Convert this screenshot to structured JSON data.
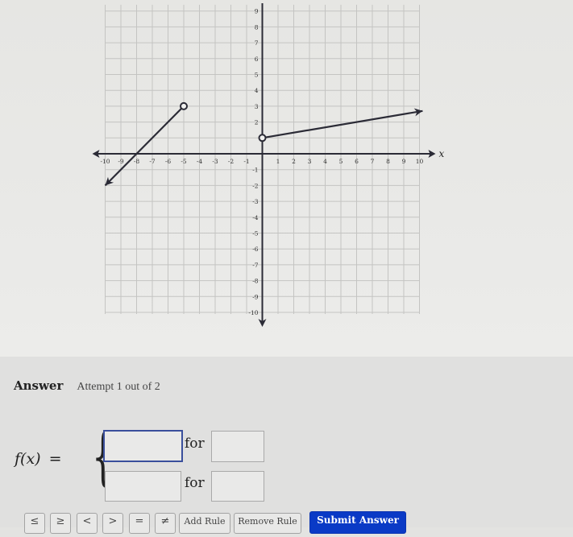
{
  "chart_data": {
    "type": "line",
    "title": "",
    "xlabel": "x",
    "ylabel": "",
    "xlim": [
      -10,
      10
    ],
    "ylim": [
      -10,
      9
    ],
    "grid": true,
    "x_ticks": [
      -10,
      -9,
      -8,
      -7,
      -6,
      -5,
      -4,
      -3,
      -2,
      -1,
      1,
      2,
      3,
      4,
      5,
      6,
      7,
      8,
      9,
      10
    ],
    "y_ticks": [
      9,
      8,
      7,
      6,
      5,
      4,
      3,
      2,
      -1,
      -2,
      -3,
      -4,
      -5,
      -6,
      -7,
      -8,
      -9,
      -10
    ],
    "series": [
      {
        "name": "left-piece",
        "points": [
          [
            -10,
            -2
          ],
          [
            -5,
            3
          ]
        ],
        "start": "arrow",
        "end": "open-circle"
      },
      {
        "name": "right-piece",
        "points": [
          [
            0,
            1
          ],
          [
            10.2,
            2.7
          ]
        ],
        "start": "open-circle",
        "end": "arrow"
      }
    ]
  },
  "answer": {
    "title": "Answer",
    "attempt": "Attempt 1 out of 2"
  },
  "formula": {
    "lhs": "f(x)",
    "equals": "=",
    "brace": "{",
    "for_label": "for",
    "rows": [
      {
        "expression": "",
        "condition": ""
      },
      {
        "expression": "",
        "condition": ""
      }
    ]
  },
  "buttons": {
    "symbols": [
      "≤",
      "≥",
      "<",
      ">",
      "=",
      "≠"
    ],
    "add_rule": "Add Rule",
    "remove_rule": "Remove Rule",
    "submit": "Submit Answer"
  },
  "colors": {
    "submit": "#0a3ac6",
    "focused_border": "#3a4f9c",
    "plot_line": "#2b2b36"
  }
}
